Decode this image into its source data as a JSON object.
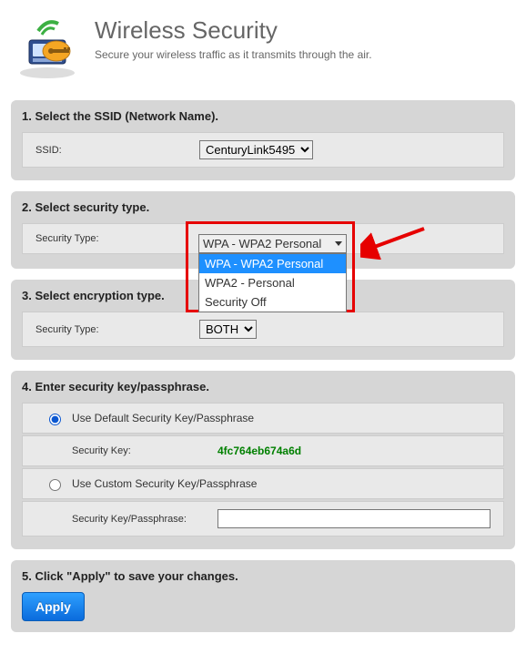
{
  "header": {
    "title": "Wireless Security",
    "subtitle": "Secure your wireless traffic as it transmits through the air."
  },
  "sections": {
    "s1": {
      "title": "1. Select the SSID (Network Name).",
      "ssid_label": "SSID:",
      "ssid_value": "CenturyLink5495"
    },
    "s2": {
      "title": "2. Select security type.",
      "label": "Security Type:",
      "selected": "WPA - WPA2 Personal",
      "options": [
        "WPA - WPA2 Personal",
        "WPA2 - Personal",
        "Security Off"
      ]
    },
    "s3": {
      "title": "3. Select encryption type.",
      "label": "Security Type:",
      "selected": "BOTH"
    },
    "s4": {
      "title": "4. Enter security key/passphrase.",
      "opt_default": "Use Default Security Key/Passphrase",
      "sec_key_label": "Security Key:",
      "sec_key_value": "4fc764eb674a6d",
      "opt_custom": "Use Custom Security Key/Passphrase",
      "custom_label": "Security Key/Passphrase:",
      "custom_value": ""
    },
    "s5": {
      "title": "5. Click \"Apply\" to save your changes.",
      "apply_label": "Apply"
    }
  }
}
